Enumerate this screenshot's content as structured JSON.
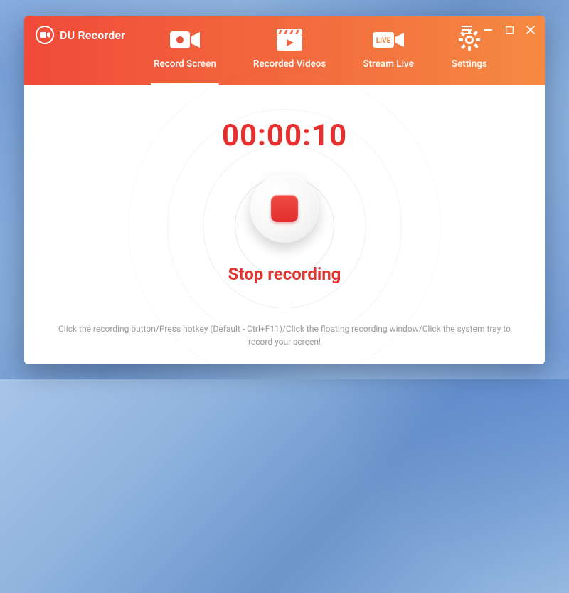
{
  "app": {
    "title": "DU Recorder"
  },
  "tabs": {
    "record": "Record Screen",
    "videos": "Recorded Videos",
    "stream": "Stream Live",
    "settings": "Settings"
  },
  "main": {
    "timer": "00:00:10",
    "status": "Stop recording",
    "hint": "Click the recording button/Press hotkey (Default - Ctrl+F11)/Click the floating recording window/Click the system tray to record your screen!"
  },
  "colors": {
    "accent": "#e6302f"
  }
}
